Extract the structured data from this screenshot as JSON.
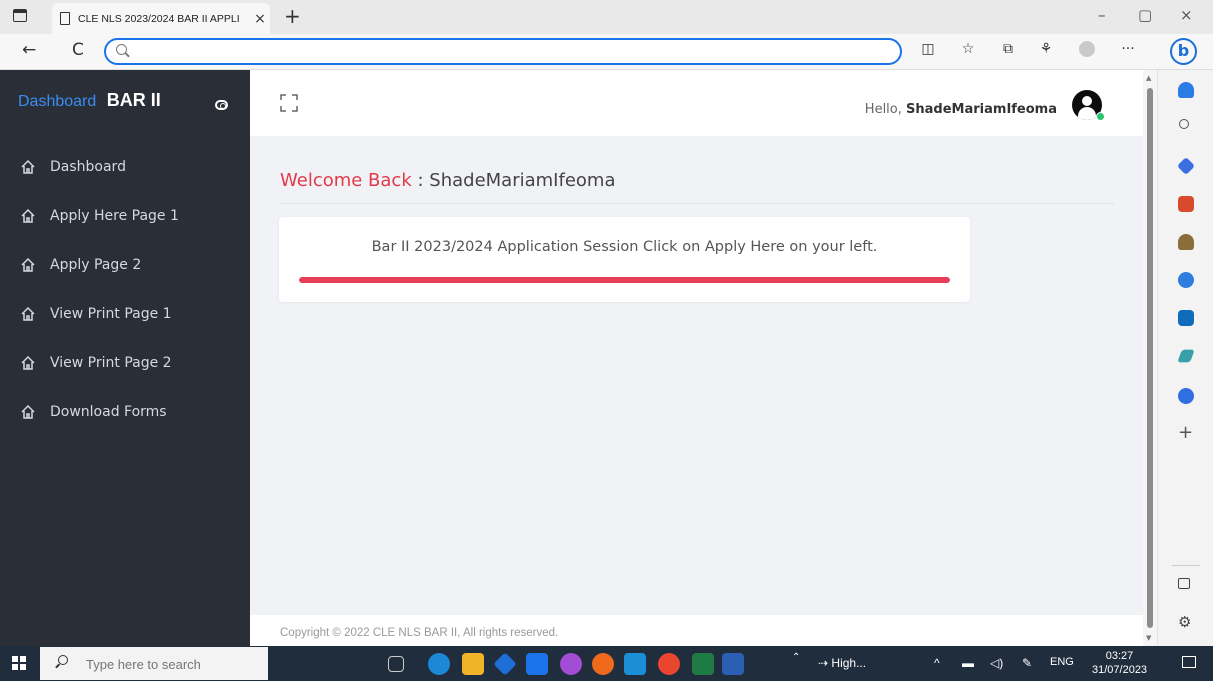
{
  "browser": {
    "tab_title": "CLE NLS 2023/2024 BAR II APPLI",
    "tab_close": "×",
    "new_tab": "+",
    "window_minimize": "–",
    "window_restore": "▢",
    "window_close": "×",
    "back": "←",
    "refresh": "C",
    "address_value": "",
    "address_placeholder": "",
    "more": "···",
    "bing_label": "b"
  },
  "app": {
    "brand_dashboard": "Dashboard",
    "brand_name": "BAR II",
    "menu": [
      {
        "label": "Dashboard"
      },
      {
        "label": "Apply Here Page 1"
      },
      {
        "label": "Apply Page 2"
      },
      {
        "label": "View Print Page 1"
      },
      {
        "label": "View Print Page 2"
      },
      {
        "label": "Download Forms"
      }
    ],
    "greeting": "Hello,",
    "user_name": "ShadeMariamIfeoma",
    "welcome_label": "Welcome Back",
    "welcome_sep": " : ",
    "welcome_user": "ShadeMariamIfeoma",
    "card_message": "Bar II 2023/2024 Application Session Click on Apply Here on your left.",
    "progress_fraction": 1.0,
    "footer": "Copyright © 2022 CLE NLS BAR II, All rights reserved.",
    "colors": {
      "accent": "#e23a4b",
      "sidebar": "#2a2e36",
      "brand_blue": "#3b8df2"
    }
  },
  "taskbar": {
    "search_placeholder": "Type here to search",
    "network_label": "High...",
    "language": "ENG",
    "time": "03:27",
    "date": "31/07/2023"
  }
}
